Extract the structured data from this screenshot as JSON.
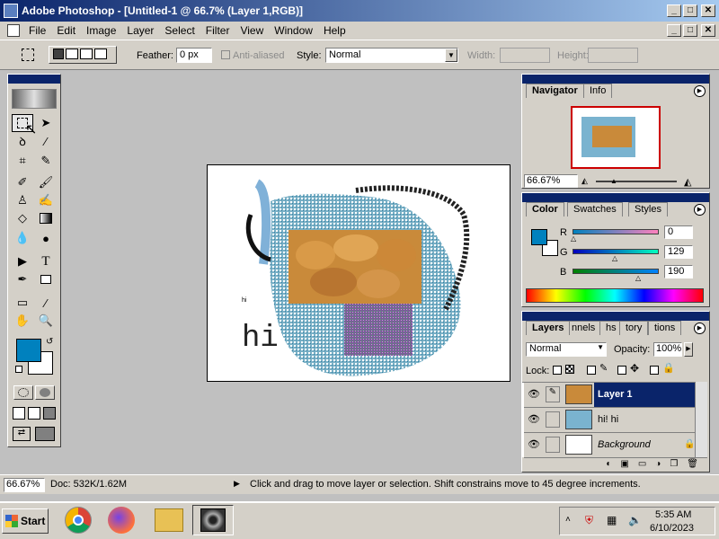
{
  "window": {
    "title": "Adobe Photoshop - [Untitled-1 @ 66.7% (Layer 1,RGB)]",
    "minimize": "_",
    "restore": "□",
    "close": "✕"
  },
  "menu": [
    "File",
    "Edit",
    "Image",
    "Layer",
    "Select",
    "Filter",
    "View",
    "Window",
    "Help"
  ],
  "options": {
    "feather_label": "Feather:",
    "feather_value": "0 px",
    "antialias_label": "Anti-aliased",
    "style_label": "Style:",
    "style_value": "Normal",
    "width_label": "Width:",
    "height_label": "Height:"
  },
  "canvas": {
    "text": "hi",
    "small_mark": "hi"
  },
  "navigator": {
    "tabs": [
      "Navigator",
      "Info"
    ],
    "zoom": "66.67%"
  },
  "color": {
    "tabs": [
      "Color",
      "Swatches",
      "Styles"
    ],
    "r_label": "R",
    "r_value": "0",
    "g_label": "G",
    "g_value": "129",
    "b_label": "B",
    "b_value": "190",
    "fg_color": "#0081be"
  },
  "layers": {
    "tabs": [
      "Layers",
      "nnels",
      "hs",
      "tory",
      "tions"
    ],
    "blend_mode": "Normal",
    "opacity_label": "Opacity:",
    "opacity_value": "100%",
    "lock_label": "Lock:",
    "items": [
      {
        "name": "Layer 1",
        "selected": true
      },
      {
        "name": "hi! hi",
        "selected": false
      },
      {
        "name": "Background",
        "selected": false
      }
    ]
  },
  "status": {
    "zoom": "66.67%",
    "doc": "Doc: 532K/1.62M",
    "hint": "Click and drag to move layer or selection. Shift constrains move to 45 degree increments."
  },
  "taskbar": {
    "start": "Start",
    "time": "5:35 AM",
    "date": "6/10/2023"
  }
}
